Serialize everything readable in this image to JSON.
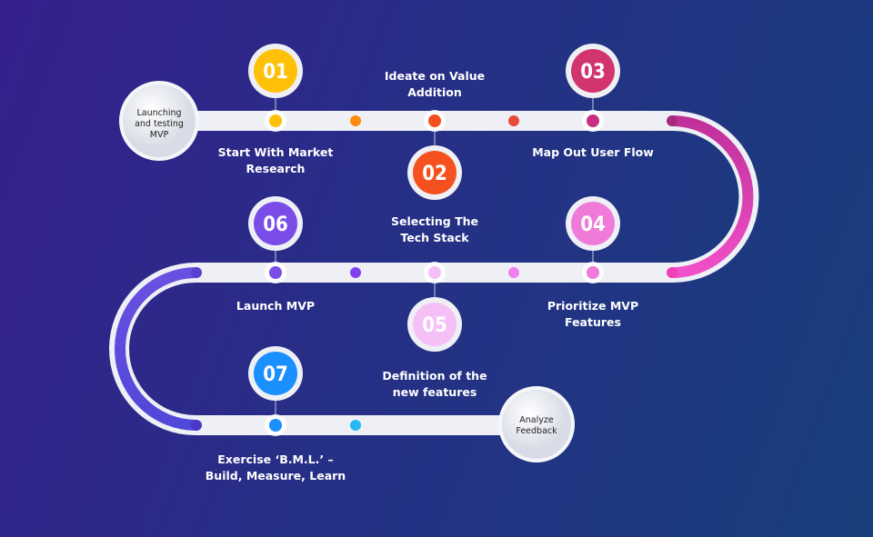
{
  "start_node": {
    "lines": [
      "Launching",
      "and testing",
      "MVP"
    ]
  },
  "end_node": {
    "lines": [
      "Analyze",
      "Feedback"
    ]
  },
  "steps": [
    {
      "number": "01",
      "lines": [
        "Start With Market",
        "Research"
      ],
      "color": "#ffc107"
    },
    {
      "number": "02",
      "lines": [
        "Ideate on Value",
        "Addition"
      ],
      "color": "#f4511e"
    },
    {
      "number": "03",
      "lines": [
        "Map Out User Flow"
      ],
      "color": "#d2356e"
    },
    {
      "number": "04",
      "lines": [
        "Selecting The",
        "Tech Stack"
      ],
      "color": "#f07ad8"
    },
    {
      "number": "05",
      "lines": [
        "Prioritize MVP",
        "Features"
      ],
      "color": "#f5c0f5"
    },
    {
      "number": "06",
      "lines": [
        "Definition of the",
        "new features"
      ],
      "color": "#7a4de8"
    },
    {
      "number": "07",
      "lines": [
        "Launch MVP"
      ],
      "color": "#1a90ff"
    },
    {
      "number": "",
      "lines": [
        "Exercise ‘B.M.L.’ –",
        "Build, Measure, Learn"
      ],
      "color": "#1a90ff"
    }
  ]
}
